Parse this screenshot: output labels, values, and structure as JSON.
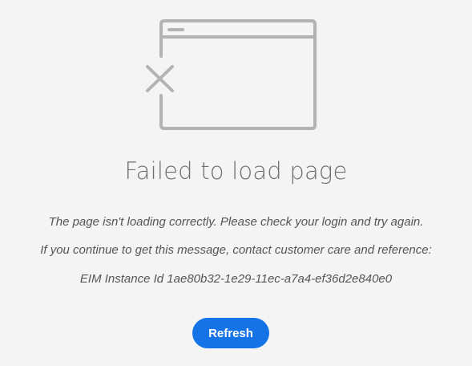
{
  "error": {
    "illustration_icon": "browser-window-error-icon",
    "title": "Failed to load page",
    "message_line1": "The page isn't loading correctly. Please check your login and try again.",
    "message_line2": "If you continue to get this message, contact customer care and reference:",
    "reference": "EIM Instance Id 1ae80b32-1e29-11ec-a7a4-ef36d2e840e0"
  },
  "actions": {
    "refresh_label": "Refresh"
  },
  "colors": {
    "background": "#f4f4f4",
    "icon_stroke": "#b3b3b3",
    "title_text": "#6e6e6e",
    "message_text": "#555555",
    "accent": "#1473e6"
  }
}
